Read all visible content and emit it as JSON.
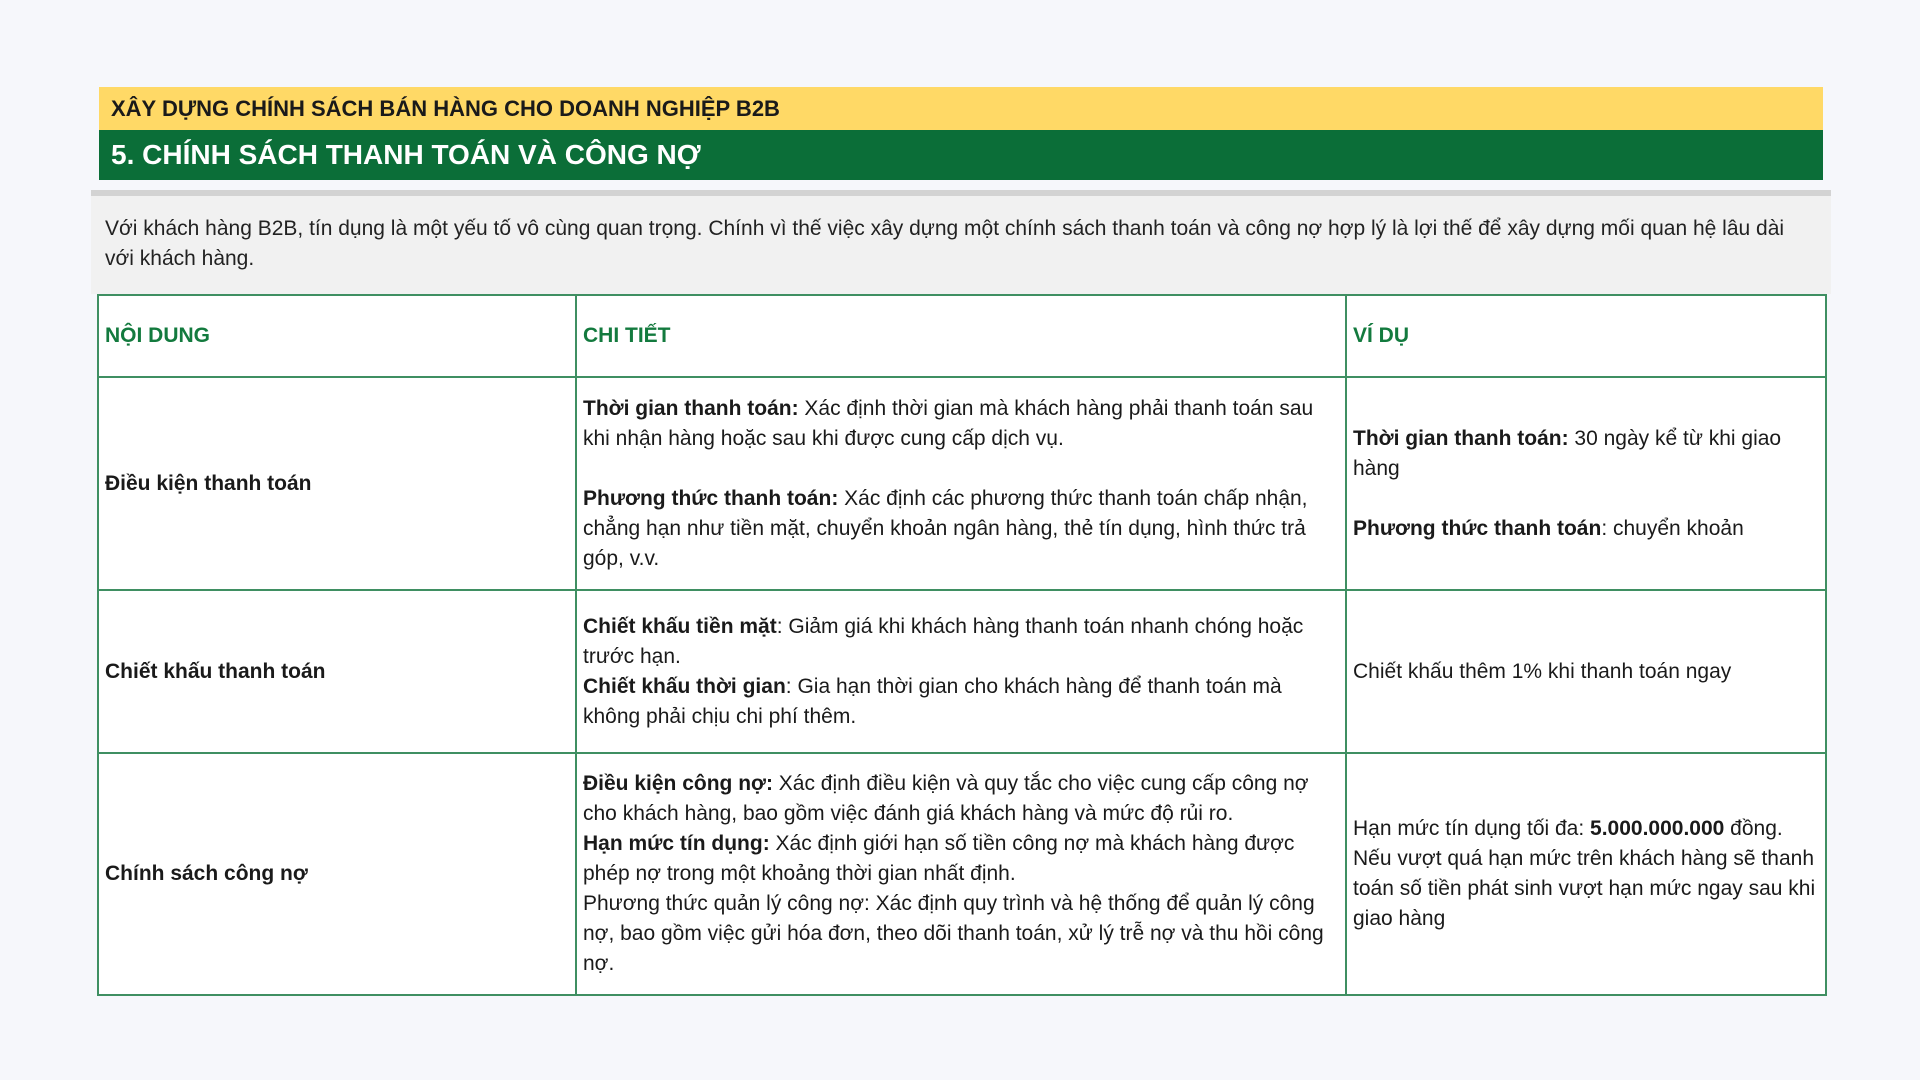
{
  "header": {
    "top_title": "XÂY DỰNG CHÍNH SÁCH BÁN HÀNG CHO DOANH NGHIỆP B2B",
    "section_title": "5. CHÍNH SÁCH THANH TOÁN VÀ CÔNG NỢ"
  },
  "intro": "Với khách hàng B2B, tín dụng là một yếu tố vô cùng quan trọng. Chính vì thế việc xây dựng một chính sách thanh toán và công nợ hợp lý là lợi thế để xây dựng mối quan hệ lâu dài với khách hàng.",
  "table": {
    "headers": [
      "NỘI DUNG",
      "CHI TIẾT",
      "VÍ DỤ"
    ],
    "rows": [
      {
        "label": "Điều kiện thanh toán",
        "detail": [
          {
            "bold": "Thời gian thanh toán:",
            "text": " Xác định thời gian mà khách hàng phải thanh toán sau khi nhận hàng hoặc sau khi được cung cấp dịch vụ."
          },
          {
            "bold": "Phương thức thanh toán:",
            "text": " Xác định các phương thức thanh toán chấp nhận, chẳng hạn như tiền mặt, chuyển khoản ngân hàng, thẻ tín dụng, hình thức trả góp, v.v."
          }
        ],
        "example": [
          {
            "bold": "Thời gian thanh toán:",
            "text": " 30 ngày kể từ khi giao hàng"
          },
          {
            "bold": "Phương thức thanh toán",
            "text": ": chuyển khoản"
          }
        ]
      },
      {
        "label": "Chiết khấu thanh toán",
        "detail": [
          {
            "bold": "Chiết khấu tiền mặt",
            "text": ": Giảm giá khi khách hàng thanh toán nhanh chóng hoặc trước hạn."
          },
          {
            "bold": "Chiết khấu thời gian",
            "text": ": Gia hạn thời gian cho khách hàng để thanh toán mà không phải chịu chi phí thêm."
          }
        ],
        "example": "Chiết khấu thêm 1% khi thanh toán ngay"
      },
      {
        "label": "Chính sách công nợ",
        "detail": [
          {
            "bold": "Điều kiện công nợ:",
            "text": " Xác định điều kiện và quy tắc cho việc cung cấp công nợ cho khách hàng, bao gồm việc đánh giá khách hàng và mức độ rủi ro."
          },
          {
            "bold": "Hạn mức tín dụng:",
            "text": " Xác định giới hạn số tiền công nợ mà khách hàng được phép nợ trong một khoảng thời gian nhất định."
          },
          {
            "bold": "",
            "text": "Phương thức quản lý công nợ: Xác định quy trình và hệ thống để quản lý công nợ, bao gồm việc gửi hóa đơn, theo dõi thanh toán, xử lý trễ nợ và thu hồi công nợ."
          }
        ],
        "example": {
          "text_before": "Hạn mức tín dụng tối đa: ",
          "bold": "5.000.000.000",
          "text_after": " đồng. Nếu vượt quá hạn mức trên khách hàng sẽ thanh toán số tiền phát sinh vượt hạn mức ngay sau khi giao hàng"
        }
      }
    ]
  }
}
